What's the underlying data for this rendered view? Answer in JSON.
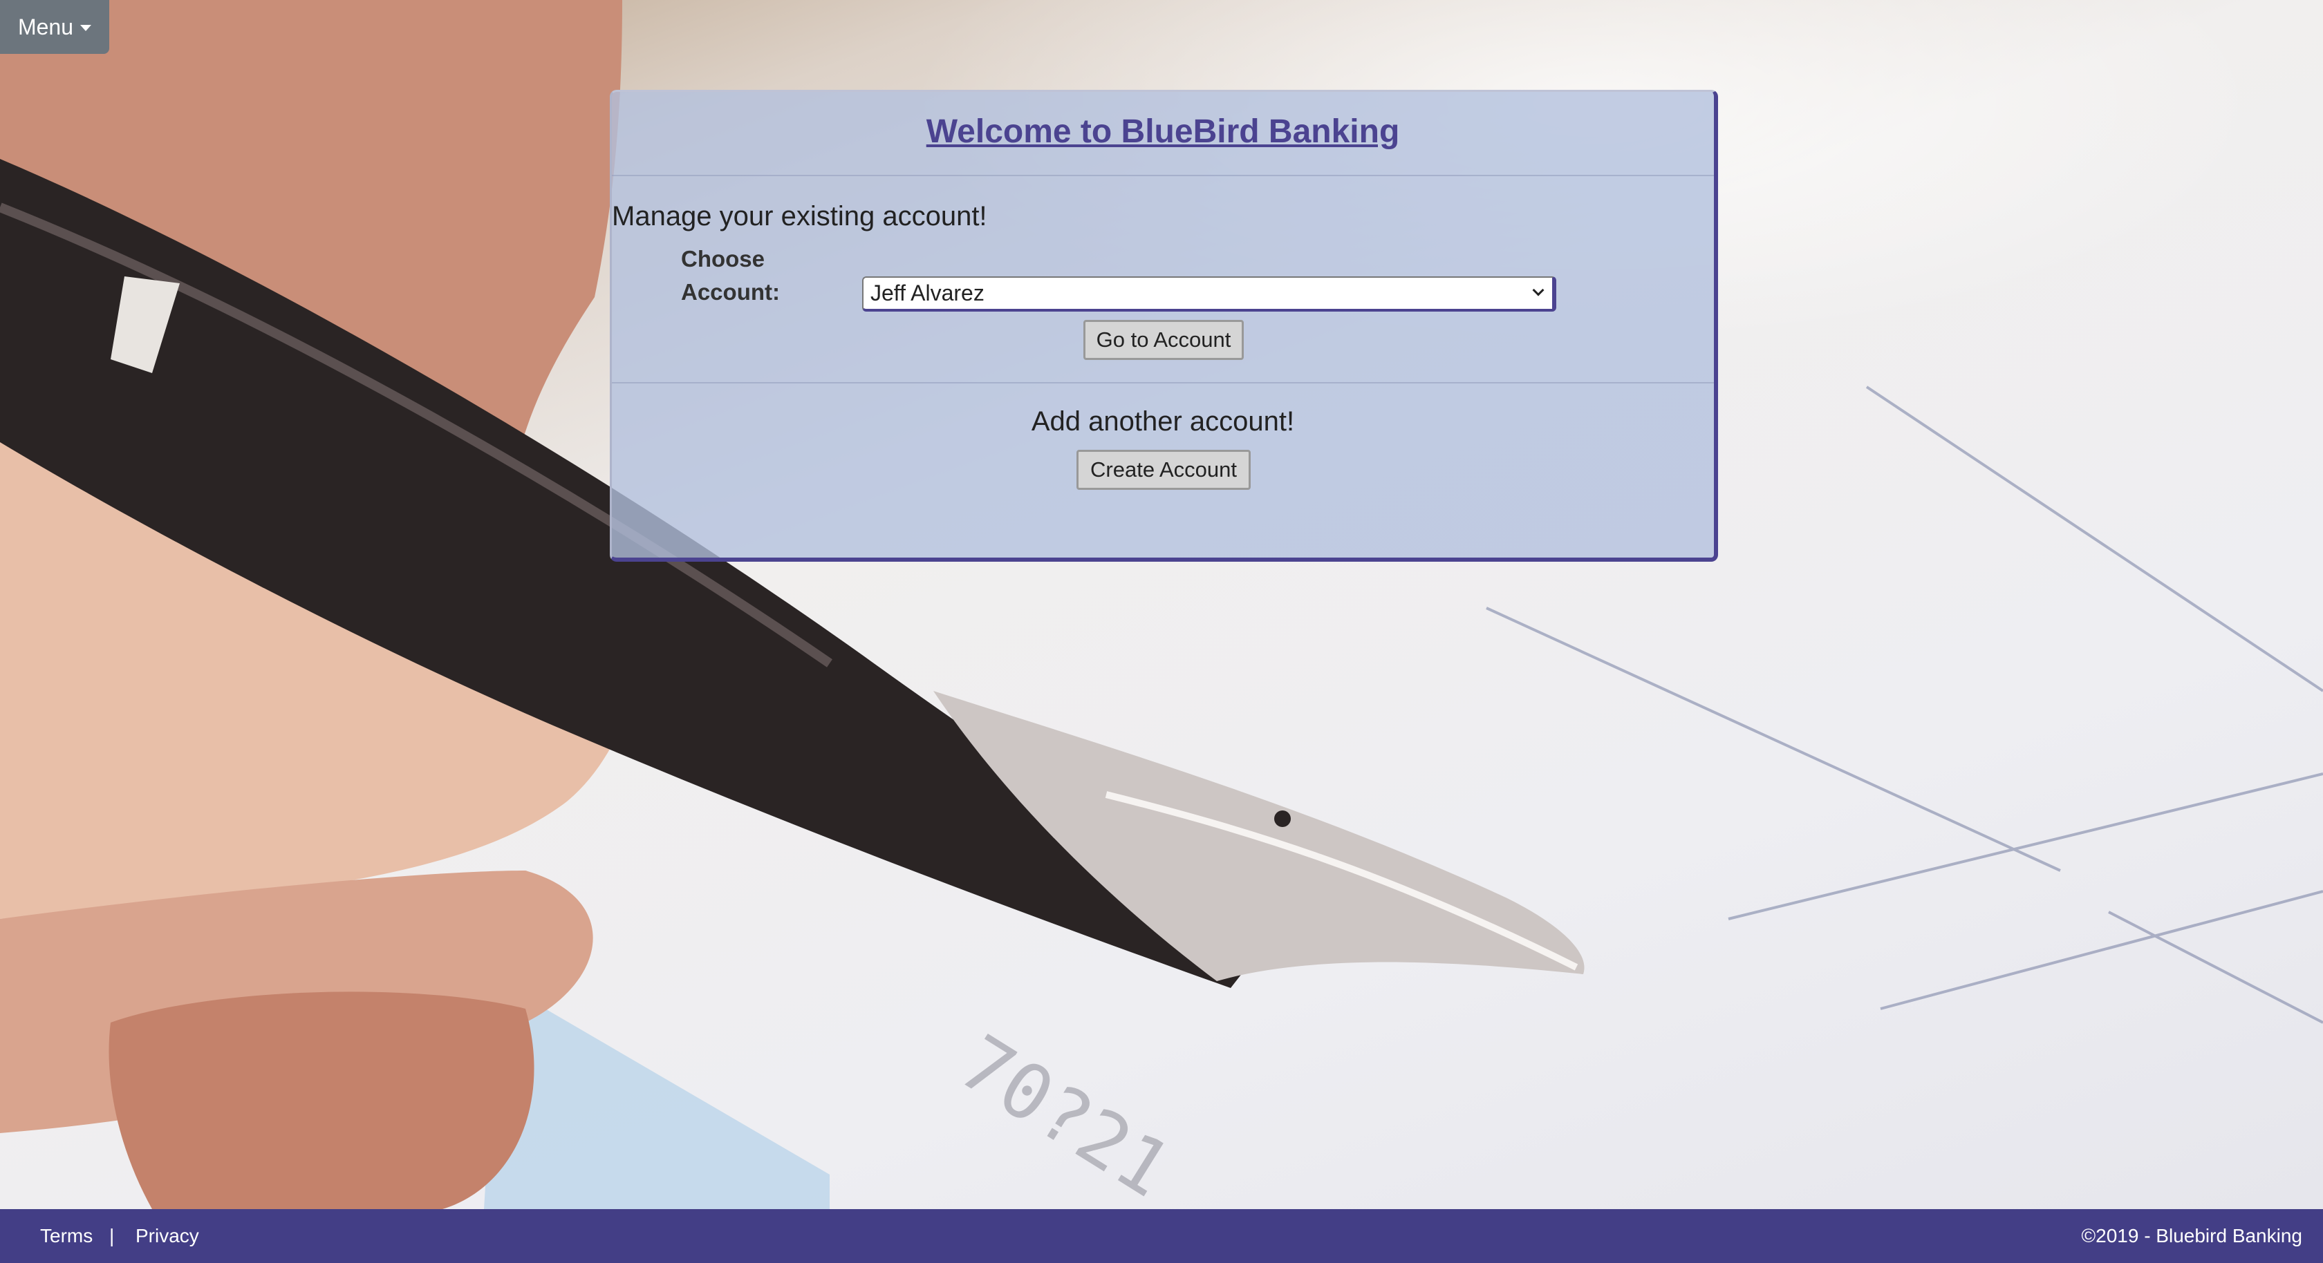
{
  "menu": {
    "label": "Menu"
  },
  "card": {
    "title": "Welcome to BlueBird Banking",
    "manage_heading": "Manage your existing account!",
    "choose_label": "Choose Account:",
    "selected_account": "Jeff Alvarez",
    "go_button": "Go to Account",
    "add_heading": "Add another account!",
    "create_button": "Create Account"
  },
  "footer": {
    "terms": "Terms",
    "separator": "|",
    "privacy": "Privacy",
    "copyright": "©2019 - Bluebird Banking"
  },
  "colors": {
    "brand": "#433e86",
    "title": "#4b4390",
    "menu_button": "#6c757d",
    "card_bg": "#b2c0de"
  },
  "icons": {
    "menu_caret": "caret-down-icon",
    "select_chevron": "chevron-down-icon"
  }
}
